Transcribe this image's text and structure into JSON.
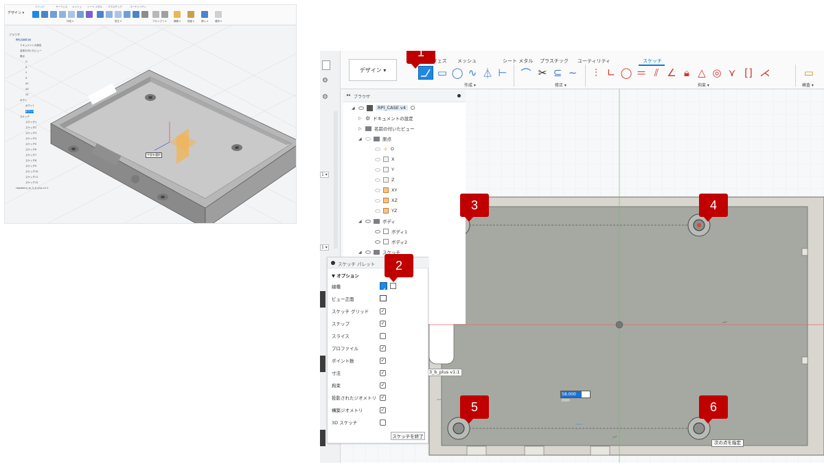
{
  "thumbnail": {
    "mode_label": "デザイン ▾",
    "tabs": [
      "ソリッド",
      "サーフェス",
      "メッシュ",
      "シート メタル",
      "プラスチック",
      "ユーティリティ"
    ],
    "groups": [
      "作成 ▾",
      "修正 ▾",
      "アセンブリ ▾",
      "構築 ▾",
      "検査 ▾",
      "挿入 ▾",
      "選択 ▾"
    ],
    "browser_title": "ブラウザ",
    "tree": [
      "RPI_CASE v4",
      "ドキュメントの設定",
      "名前の付いたビュー",
      "原点",
      "O",
      "X",
      "Y",
      "Z",
      "XY",
      "XZ",
      "YZ",
      "ボディ",
      "ボディ1",
      "ボディ2",
      "スケッチ",
      "スケッチ1",
      "スケッチ2",
      "スケッチ3",
      "スケッチ4",
      "スケッチ5",
      "スケッチ6",
      "スケッチ7",
      "スケッチ8",
      "スケッチ9",
      "スケッチ10",
      "スケッチ11",
      "スケッチ12",
      "raspberry_pi_3_b_plus v1:1"
    ],
    "model_label": "平面を選択"
  },
  "main": {
    "left_badges": [
      "1 ▾",
      "1 ▾"
    ],
    "toolbar": {
      "mode_label": "デザイン ▾",
      "tabs": [
        "サーフェス",
        "メッシュ",
        "シート メタル",
        "プラスチック",
        "ユーティリティ",
        "スケッチ"
      ],
      "active_tab": "スケッチ",
      "groups": {
        "create": "作成 ▾",
        "modify": "修正 ▾",
        "constraint": "拘束 ▾",
        "inspect": "検査 ▾"
      },
      "icons": {
        "line": "line-icon",
        "rectangle": "rectangle-icon",
        "circle": "circle-icon",
        "spline": "spline-icon",
        "mirror": "mirror-icon",
        "slot": "slot-icon",
        "fillet": "fillet-icon",
        "trim": "trim-icon",
        "offset": "offset-icon",
        "curve": "curve-icon",
        "project": "project-icon",
        "coincident": "coincident-icon",
        "tangent": "tangent-icon",
        "equal": "equal-icon",
        "parallel": "parallel-icon",
        "perpendicular": "perpendicular-icon",
        "fix": "lock-icon",
        "triangle": "triangle-icon",
        "concentric": "concentric-icon",
        "collinear": "collinear-icon",
        "symmetric": "symmetric-icon",
        "midpoint": "midpoint-icon",
        "measure": "measure-icon"
      },
      "colors": {
        "active_blue": "#1e88e5",
        "constraint_red": "#d33535"
      }
    },
    "browser": {
      "title": "ブラウザ",
      "root": "RPI_CASE v4",
      "items": {
        "doc_settings": "ドキュメントの設定",
        "named_views": "名前の付いたビュー",
        "origin": "原点",
        "origin_o": "O",
        "axis_x": "X",
        "axis_y": "Y",
        "axis_z": "Z",
        "plane_xy": "XY",
        "plane_xz": "XZ",
        "plane_yz": "YZ",
        "bodies": "ボディ",
        "body1": "ボディ1",
        "body2": "ボディ2",
        "sketches": "スケッチ"
      }
    },
    "palette": {
      "title": "スケッチ パレット",
      "options_header": "▼ オプション",
      "rows": [
        {
          "label": "線種"
        },
        {
          "label": "ビュー正面"
        },
        {
          "label": "スケッチ グリッド",
          "checked": true
        },
        {
          "label": "スナップ",
          "checked": true
        },
        {
          "label": "スライス",
          "checked": false
        },
        {
          "label": "プロファイル",
          "checked": true
        },
        {
          "label": "ポイント数",
          "checked": true
        },
        {
          "label": "寸法",
          "checked": true
        },
        {
          "label": "拘束",
          "checked": true
        },
        {
          "label": "投影されたジオメトリ",
          "checked": true
        },
        {
          "label": "構築ジオメトリ",
          "checked": true
        },
        {
          "label": "3D スケッチ",
          "checked": false
        }
      ],
      "finish_label": "スケッチを終了",
      "check_glyph": "✓"
    },
    "viewport": {
      "component_label": "3_b_plus v1:1",
      "dimension_value": "58.000 mm",
      "tooltip": "次の点を指定"
    },
    "callouts": [
      "1",
      "2",
      "3",
      "4",
      "5",
      "6"
    ],
    "callout_color": "#c00000"
  }
}
